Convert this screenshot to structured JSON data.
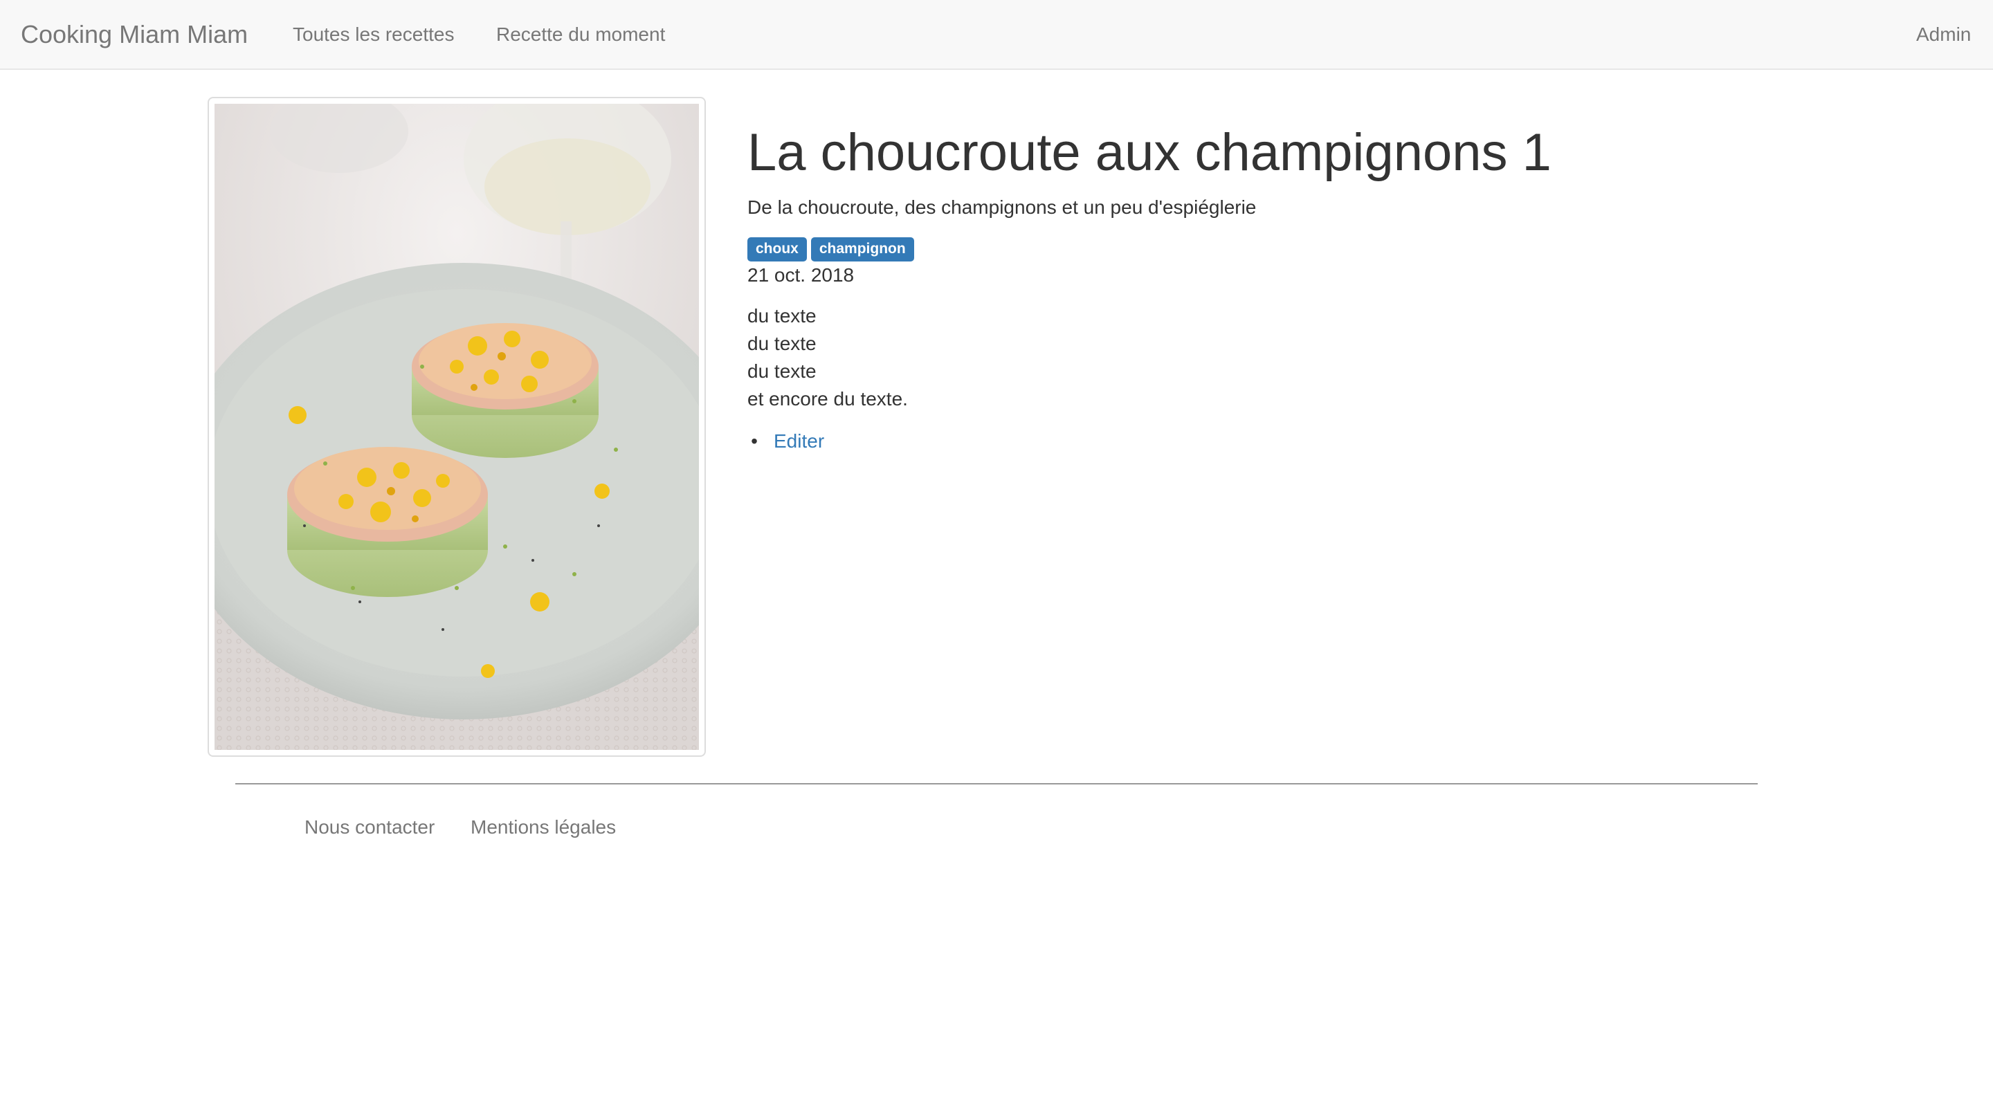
{
  "navbar": {
    "brand": "Cooking Miam Miam",
    "links": [
      "Toutes les recettes",
      "Recette du moment"
    ],
    "admin": "Admin"
  },
  "recipe": {
    "title": "La choucroute aux champignons 1",
    "subtitle": "De la choucroute, des champignons et un peu d'espiéglerie",
    "tags": [
      "choux",
      "champignon"
    ],
    "date": "21 oct. 2018",
    "body": [
      "du texte",
      "du texte",
      "du texte",
      "et encore du texte."
    ],
    "edit_label": "Editer"
  },
  "footer": {
    "links": [
      "Nous contacter",
      "Mentions légales"
    ]
  }
}
